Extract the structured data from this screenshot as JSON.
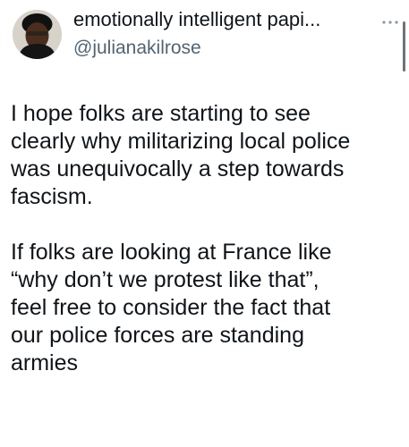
{
  "author": {
    "display_name": "emotionally intelligent papi...",
    "handle": "@julianakilrose",
    "avatar_icon": "profile-photo"
  },
  "menu": {
    "more_icon": "ellipsis-icon"
  },
  "tweet": {
    "paragraph_1": "I hope folks are starting to see\nclearly why militarizing local police\nwas unequivocally a step towards\nfascism.",
    "paragraph_2": "If folks are looking at France like\n“why don’t we protest like that”,\nfeel free to consider the fact that\nour police forces are standing\narmies"
  },
  "colors": {
    "text": "#0f1419",
    "secondary_text": "#536471",
    "background": "#ffffff"
  }
}
